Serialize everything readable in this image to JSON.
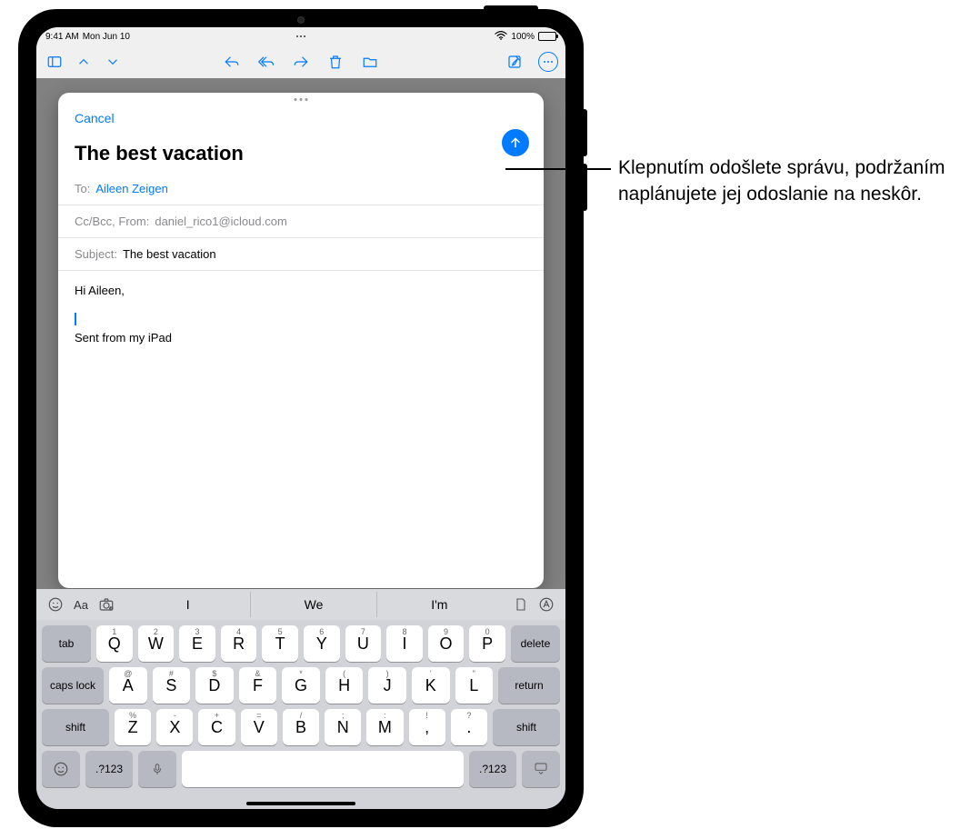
{
  "status": {
    "time": "9:41 AM",
    "date": "Mon Jun 10",
    "battery": "100%"
  },
  "compose": {
    "cancel": "Cancel",
    "title": "The best vacation",
    "to_label": "To:",
    "to_value": "Aileen Zeigen",
    "ccbcc_label": "Cc/Bcc, From:",
    "from_value": "daniel_rico1@icloud.com",
    "subject_label": "Subject:",
    "subject_value": "The best vacation",
    "body_greeting": "Hi Aileen,",
    "body_signature": "Sent from my iPad"
  },
  "suggestions": {
    "w1": "I",
    "w2": "We",
    "w3": "I'm"
  },
  "keyboard": {
    "row1": [
      {
        "main": "Q",
        "alt": "1"
      },
      {
        "main": "W",
        "alt": "2"
      },
      {
        "main": "E",
        "alt": "3"
      },
      {
        "main": "R",
        "alt": "4"
      },
      {
        "main": "T",
        "alt": "5"
      },
      {
        "main": "Y",
        "alt": "6"
      },
      {
        "main": "U",
        "alt": "7"
      },
      {
        "main": "I",
        "alt": "8"
      },
      {
        "main": "O",
        "alt": "9"
      },
      {
        "main": "P",
        "alt": "0"
      }
    ],
    "row2": [
      {
        "main": "A",
        "alt": "@"
      },
      {
        "main": "S",
        "alt": "#"
      },
      {
        "main": "D",
        "alt": "$"
      },
      {
        "main": "F",
        "alt": "&"
      },
      {
        "main": "G",
        "alt": "*"
      },
      {
        "main": "H",
        "alt": "("
      },
      {
        "main": "J",
        "alt": ")"
      },
      {
        "main": "K",
        "alt": "'"
      },
      {
        "main": "L",
        "alt": "\""
      }
    ],
    "row3": [
      {
        "main": "Z",
        "alt": "%"
      },
      {
        "main": "X",
        "alt": "-"
      },
      {
        "main": "C",
        "alt": "+"
      },
      {
        "main": "V",
        "alt": "="
      },
      {
        "main": "B",
        "alt": "/"
      },
      {
        "main": "N",
        "alt": ";"
      },
      {
        "main": "M",
        "alt": ":"
      },
      {
        "main": ",",
        "alt": "!"
      },
      {
        "main": ".",
        "alt": "?"
      }
    ],
    "tab": "tab",
    "delete": "delete",
    "caps": "caps lock",
    "return": "return",
    "shift": "shift",
    "num": ".?123"
  },
  "callout": {
    "text": "Klepnutím odošlete správu, podržaním naplánujete jej odoslanie na neskôr."
  }
}
